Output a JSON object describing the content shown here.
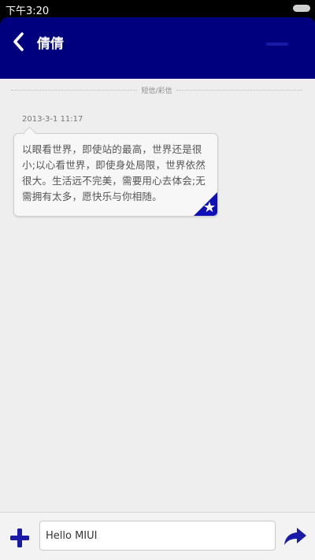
{
  "status_bar": {
    "time": "下午3:20"
  },
  "header": {
    "contact_name": "倩倩"
  },
  "conversation": {
    "divider_label": "短信/彩信",
    "messages": [
      {
        "timestamp": "2013-3-1 11:17",
        "text": "以眼看世界，即使站的最高，世界还是很小;以心看世界，即使身处局限，世界依然很大。生活远不完美，需要用心去体会;无需拥有太多，愿快乐与你相随。",
        "starred": true
      }
    ]
  },
  "composer": {
    "input_value": "Hello MIUI"
  },
  "colors": {
    "accent": "#00007f",
    "icon_blue": "#1a1aa8"
  },
  "icons": {
    "back": "chevron-left-icon",
    "add": "plus-icon",
    "send": "send-arrow-icon",
    "star": "star-icon"
  }
}
